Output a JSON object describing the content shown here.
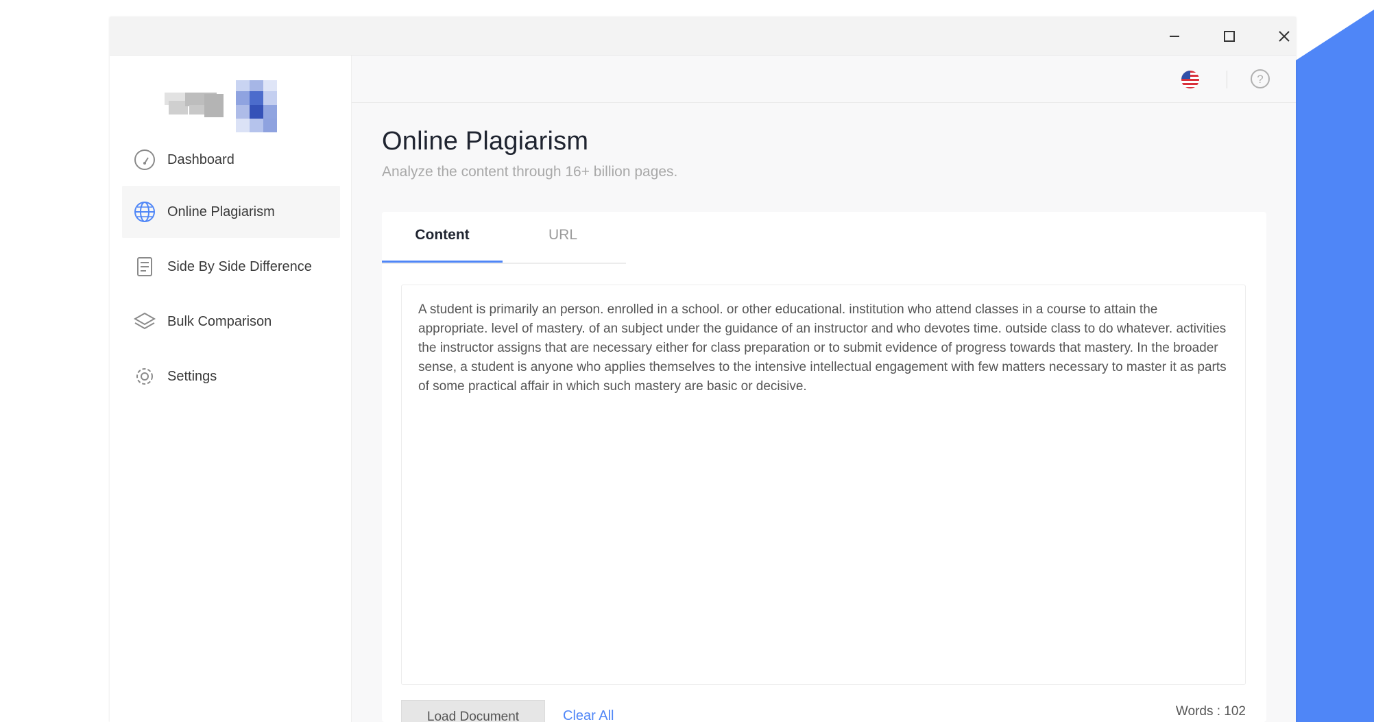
{
  "colors": {
    "accent": "#4f86f7",
    "text_primary": "#1f2430",
    "text_muted": "#a8a8a8"
  },
  "window": {
    "controls": {
      "minimize_icon": "minimize-icon",
      "maximize_icon": "maximize-icon",
      "close_icon": "close-icon"
    }
  },
  "sidebar": {
    "logo": "pixelated-logo",
    "items": [
      {
        "label": "Dashboard",
        "icon": "dashboard-gauge-icon",
        "active": false
      },
      {
        "label": "Online Plagiarism",
        "icon": "globe-icon",
        "active": true
      },
      {
        "label": "Side By Side Difference",
        "icon": "document-icon",
        "active": false
      },
      {
        "label": "Bulk Comparison",
        "icon": "layers-icon",
        "active": false
      },
      {
        "label": "Settings",
        "icon": "gear-icon",
        "active": false
      }
    ]
  },
  "topbar": {
    "language_icon": "us-flag-icon",
    "help_icon": "help-icon"
  },
  "main": {
    "title": "Online Plagiarism",
    "subtitle": "Analyze the content through 16+ billion pages.",
    "tabs": [
      {
        "label": "Content",
        "active": true
      },
      {
        "label": "URL",
        "active": false
      }
    ],
    "content_text": "A student is primarily an person. enrolled in a school. or other educational. institution who attend classes in a course to attain the appropriate. level of mastery. of an subject under the guidance of an instructor and who devotes time. outside class to do whatever. activities the instructor assigns that are necessary either for class preparation or to submit evidence of progress towards that mastery. In the broader sense, a student is anyone who applies themselves to the intensive intellectual engagement with few matters necessary to master it as parts of some practical affair in which such mastery are basic or decisive.",
    "load_button_label": "Load Document",
    "clear_label": "Clear All",
    "word_count": "Words : 102"
  }
}
